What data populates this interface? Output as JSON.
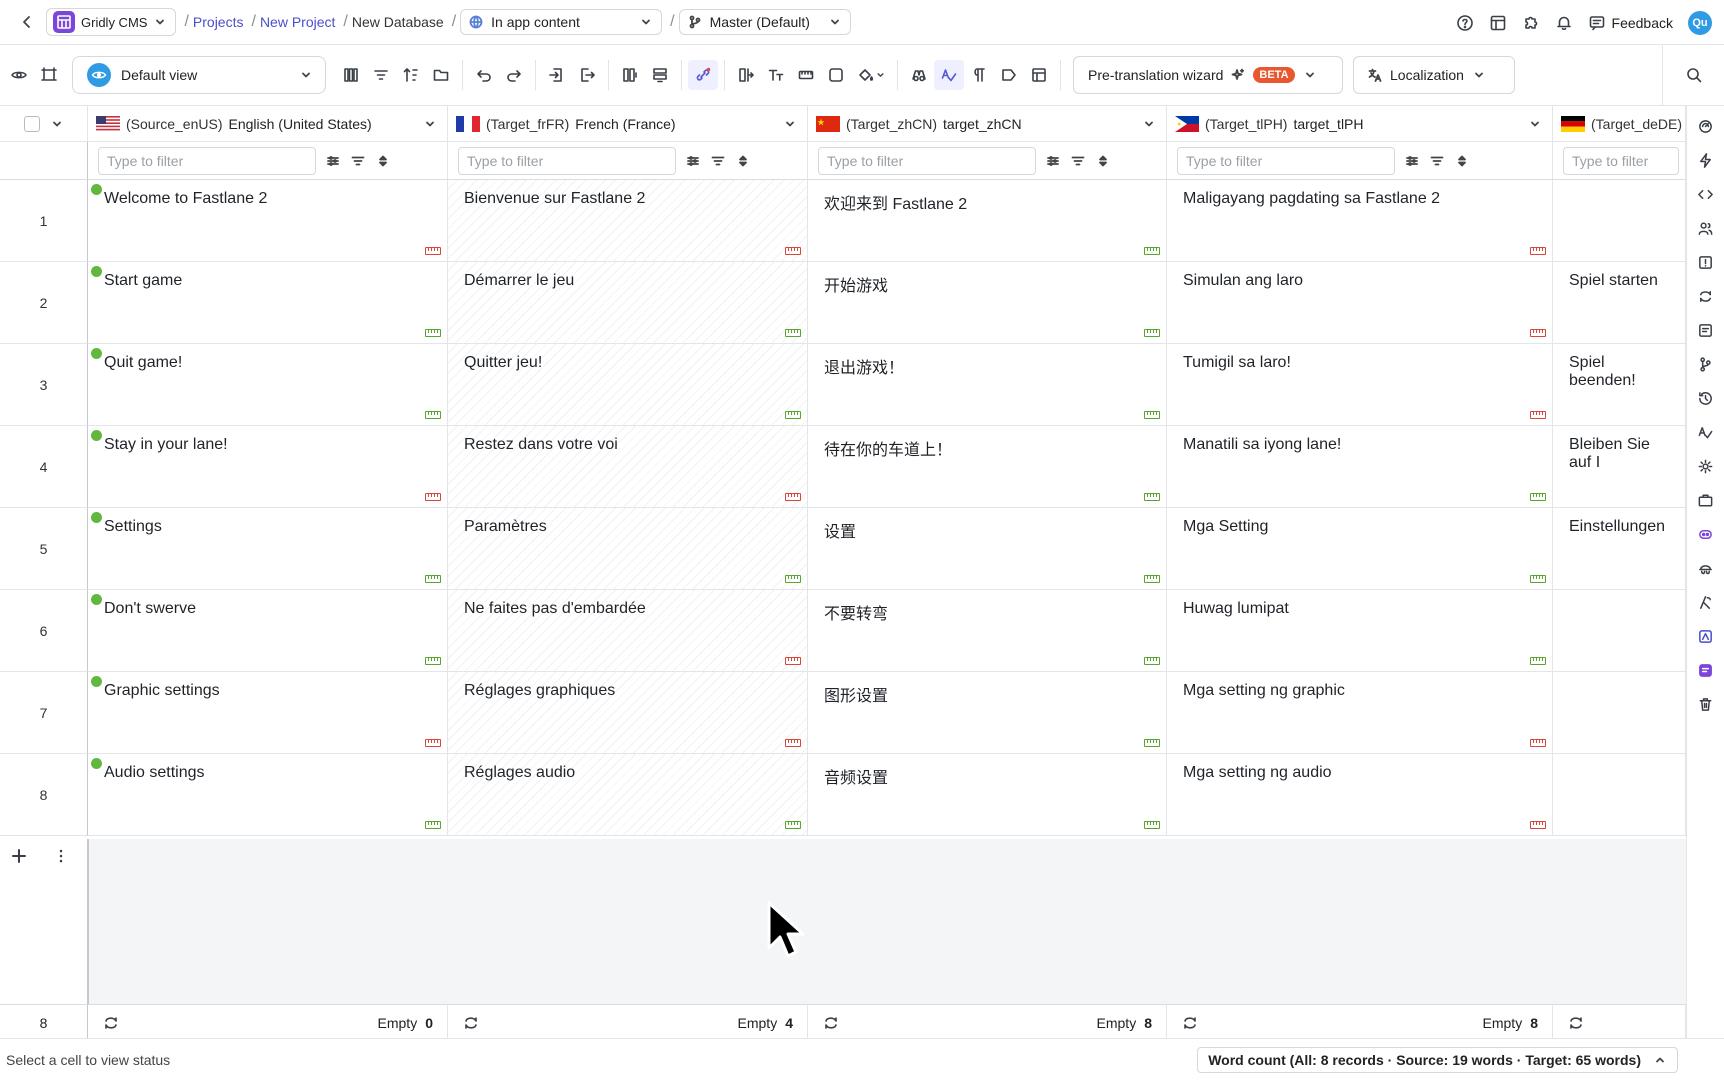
{
  "topbar": {
    "app_name": "Gridly CMS",
    "breadcrumbs": [
      "Projects",
      "New Project",
      "New Database"
    ],
    "content_select": "In app content",
    "branch_select": "Master (Default)",
    "feedback_label": "Feedback",
    "avatar_initials": "Qu"
  },
  "toolbar": {
    "view_label": "Default view",
    "pretranslation_label": "Pre-translation wizard",
    "beta_label": "BETA",
    "localization_label": "Localization"
  },
  "columns": [
    {
      "tag": "(Source_enUS)",
      "name": "English (United States)",
      "flag": "us",
      "placeholder": "Type to filter",
      "empty_label": "Empty",
      "empty_count": "0"
    },
    {
      "tag": "(Target_frFR)",
      "name": "French (France)",
      "flag": "fr",
      "placeholder": "Type to filter",
      "empty_label": "Empty",
      "empty_count": "4"
    },
    {
      "tag": "(Target_zhCN)",
      "name": "target_zhCN",
      "flag": "cn",
      "placeholder": "Type to filter",
      "empty_label": "Empty",
      "empty_count": "8"
    },
    {
      "tag": "(Target_tlPH)",
      "name": "target_tlPH",
      "flag": "ph",
      "placeholder": "Type to filter",
      "empty_label": "Empty",
      "empty_count": "8"
    },
    {
      "tag": "(Target_deDE)",
      "name": "",
      "flag": "de",
      "placeholder": "Type to filter",
      "empty_label": "",
      "empty_count": ""
    }
  ],
  "rows": [
    {
      "num": "1",
      "cells": [
        "Welcome to Fastlane 2",
        "Bienvenue sur Fastlane 2",
        "欢迎来到 Fastlane 2",
        "Maligayang pagdating sa Fastlane 2",
        ""
      ],
      "rulers": [
        "warn",
        "warn",
        "ok",
        "warn",
        ""
      ]
    },
    {
      "num": "2",
      "cells": [
        "Start game",
        "Démarrer le jeu",
        "开始游戏",
        "Simulan ang laro",
        "Spiel starten"
      ],
      "rulers": [
        "ok",
        "ok",
        "ok",
        "warn",
        ""
      ]
    },
    {
      "num": "3",
      "cells": [
        "Quit game!",
        "Quitter jeu!",
        "退出游戏！",
        "Tumigil sa laro!",
        "Spiel beenden!"
      ],
      "rulers": [
        "ok",
        "ok",
        "ok",
        "warn",
        ""
      ]
    },
    {
      "num": "4",
      "cells": [
        "Stay in your lane!",
        "Restez dans votre voi",
        "待在你的车道上！",
        "Manatili sa iyong lane!",
        "Bleiben Sie auf I"
      ],
      "rulers": [
        "warn",
        "warn",
        "ok",
        "ok",
        ""
      ]
    },
    {
      "num": "5",
      "cells": [
        "Settings",
        "Paramètres",
        "设置",
        "Mga Setting",
        "Einstellungen"
      ],
      "rulers": [
        "ok",
        "ok",
        "ok",
        "ok",
        ""
      ]
    },
    {
      "num": "6",
      "cells": [
        "Don't swerve",
        "Ne faites pas d'embardée",
        "不要转弯",
        "Huwag lumipat",
        ""
      ],
      "rulers": [
        "ok",
        "warn",
        "ok",
        "ok",
        ""
      ]
    },
    {
      "num": "7",
      "cells": [
        "Graphic settings",
        "Réglages graphiques",
        "图形设置",
        "Mga setting ng graphic",
        ""
      ],
      "rulers": [
        "warn",
        "warn",
        "ok",
        "warn",
        ""
      ]
    },
    {
      "num": "8",
      "cells": [
        "Audio settings",
        "Réglages audio",
        "音频设置",
        "Mga setting ng audio",
        ""
      ],
      "rulers": [
        "ok",
        "ok",
        "ok",
        "warn",
        ""
      ]
    }
  ],
  "footer": {
    "record_count": "8"
  },
  "statusbar": {
    "message": "Select a cell to view status",
    "word_count": "Word count (All: 8 records · Source: 19 words · Target: 65 words)"
  },
  "colors": {
    "accent": "#4b4fc9",
    "status_ok": "#5aa62c",
    "status_warn": "#d9463b",
    "brand": "#7b46d9"
  }
}
